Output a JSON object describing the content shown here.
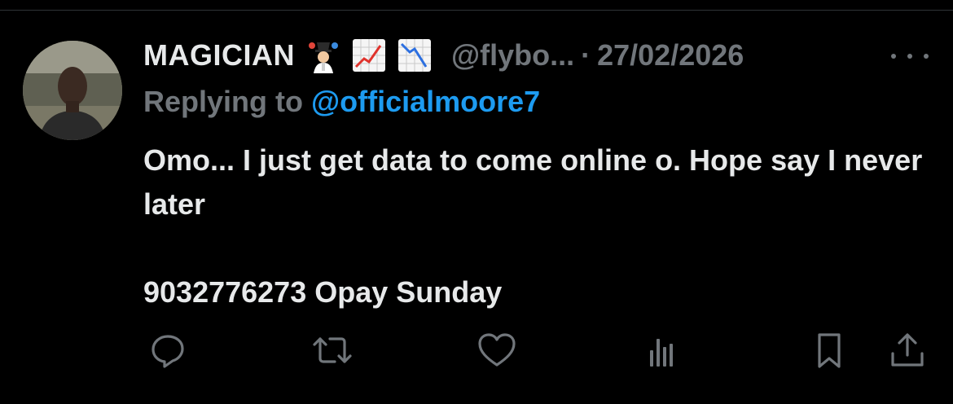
{
  "tweet": {
    "display_name": "MAGICIAN",
    "name_emojis": [
      "juggling-person-emoji",
      "chart-increasing-emoji",
      "chart-decreasing-emoji"
    ],
    "handle": "@flybo...",
    "separator": "·",
    "date": "27/02/2026",
    "reply_prefix": "Replying to ",
    "reply_handle": "@officialmoore7",
    "body_lines": [
      "Omo... I just get data to come online o. Hope say I never later",
      "9032776273 Opay Sunday"
    ]
  },
  "actions": [
    {
      "name": "reply-button",
      "icon": "speech-bubble-icon"
    },
    {
      "name": "retweet-button",
      "icon": "retweet-arrows-icon"
    },
    {
      "name": "like-button",
      "icon": "heart-icon"
    },
    {
      "name": "views-button",
      "icon": "bar-chart-icon"
    },
    {
      "name": "bookmark-button",
      "icon": "bookmark-icon"
    },
    {
      "name": "share-button",
      "icon": "share-upload-icon"
    }
  ],
  "colors": {
    "background": "#000000",
    "primary_text": "#e7e9ea",
    "secondary_text": "#71767b",
    "link": "#1d9bf0",
    "divider": "#2f3336"
  }
}
